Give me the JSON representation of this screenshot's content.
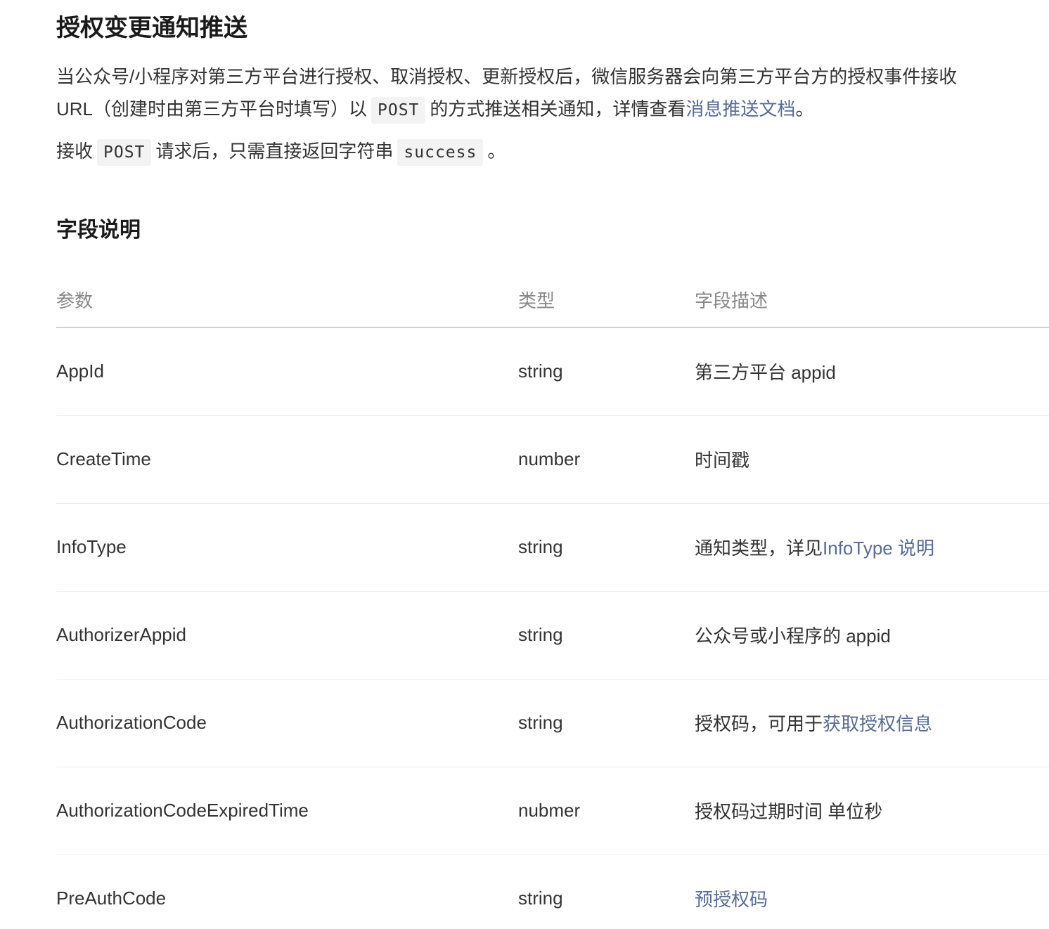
{
  "heading": "授权变更通知推送",
  "intro": {
    "line1": "当公众号/小程序对第三方平台进行授权、取消授权、更新授权后，微信服务器会向第三方平台方的授权事件接收",
    "line2_before": "URL（创建时由第三方平台时填写）以",
    "line2_code": "POST",
    "line2_middle": "的方式推送相关通知，详情查看",
    "line2_link": "消息推送文档",
    "line2_end": "。",
    "line3_before": "接收",
    "line3_code1": "POST",
    "line3_middle": "请求后，只需直接返回字符串",
    "line3_code2": "success",
    "line3_end": "。"
  },
  "fields_section": {
    "title": "字段说明",
    "headers": {
      "param": "参数",
      "type": "类型",
      "desc": "字段描述"
    },
    "rows": [
      {
        "param": "AppId",
        "type": "string",
        "desc_text": "第三方平台 appid",
        "desc_link": ""
      },
      {
        "param": "CreateTime",
        "type": "number",
        "desc_text": "时间戳",
        "desc_link": ""
      },
      {
        "param": "InfoType",
        "type": "string",
        "desc_text": "通知类型，详见",
        "desc_link": "InfoType 说明"
      },
      {
        "param": "AuthorizerAppid",
        "type": "string",
        "desc_text": "公众号或小程序的 appid",
        "desc_link": ""
      },
      {
        "param": "AuthorizationCode",
        "type": "string",
        "desc_text": "授权码，可用于",
        "desc_link": "获取授权信息"
      },
      {
        "param": "AuthorizationCodeExpiredTime",
        "type": "nubmer",
        "desc_text": "授权码过期时间 单位秒",
        "desc_link": ""
      },
      {
        "param": "PreAuthCode",
        "type": "string",
        "desc_text": "",
        "desc_link": "预授权码"
      }
    ]
  },
  "colors": {
    "link": "#576b95",
    "text": "#333333",
    "header_text": "#888888",
    "code_bg": "#f3f3f3"
  }
}
